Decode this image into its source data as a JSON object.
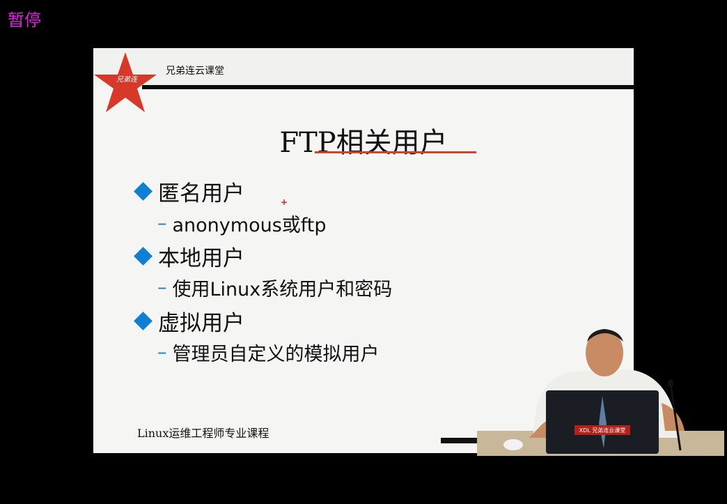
{
  "player": {
    "pause_label": "暂停"
  },
  "slide": {
    "brand_text": "兄弟连云课堂",
    "logo_text": "兄弟连",
    "title": "FTP相关用户",
    "bullets": [
      {
        "label": "匿名用户",
        "sub": "anonymous或ftp"
      },
      {
        "label": "本地用户",
        "sub": "使用Linux系统用户和密码"
      },
      {
        "label": "虚拟用户",
        "sub": "管理员自定义的模拟用户"
      }
    ],
    "footer": "Linux运维工程师专业课程"
  },
  "presenter": {
    "laptop_label": "XDL 兄弟连云课堂"
  },
  "colors": {
    "pause": "#e020e0",
    "star": "#d6382a",
    "diamond": "#0f7fd6",
    "underline": "#d0432b"
  }
}
